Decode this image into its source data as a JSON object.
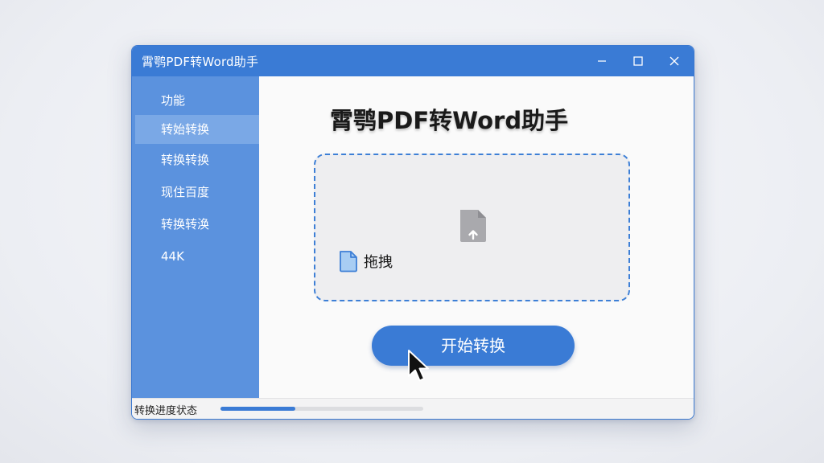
{
  "window": {
    "title": "霄鹗PDF转Word助手",
    "accent_color": "#3a7bd5",
    "sidebar_color": "#5b92de"
  },
  "titlebar_buttons": {
    "minimize_icon": "minimize-icon",
    "maximize_icon": "maximize-icon",
    "close_icon": "close-icon"
  },
  "sidebar": {
    "items": [
      {
        "label": "功能",
        "active": false
      },
      {
        "label": "转始转换",
        "active": true
      },
      {
        "label": "转换转换",
        "active": false
      },
      {
        "label": "现住百度",
        "active": false
      },
      {
        "label": "转换转涣",
        "active": false
      },
      {
        "label": "44K",
        "active": false
      }
    ]
  },
  "main": {
    "heading": "霄鹗PDF转Word助手",
    "dropzone": {
      "center_icon": "file-upload-icon",
      "drag_icon": "document-icon",
      "drag_label": "拖拽"
    },
    "start_button_label": "开始转换"
  },
  "statusbar": {
    "status_text": "转换进度状态",
    "progress_fraction": 0.37
  }
}
